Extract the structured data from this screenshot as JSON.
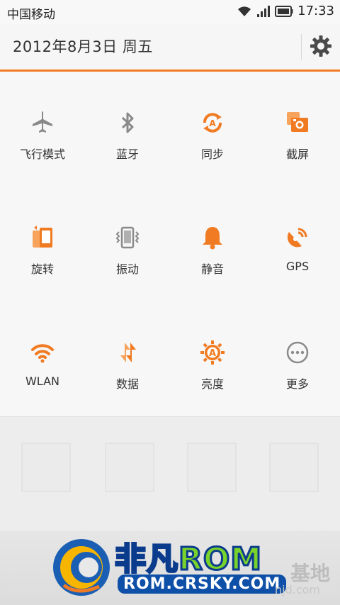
{
  "status_bar": {
    "carrier": "中国移动",
    "time": "17:33",
    "icons": [
      "wifi-icon",
      "signal-icon",
      "battery-icon"
    ]
  },
  "header": {
    "date": "2012年8月3日 周五",
    "settings_icon": "gear-icon"
  },
  "toggles": [
    {
      "label": "飞行模式",
      "icon": "airplane-icon",
      "active": false
    },
    {
      "label": "蓝牙",
      "icon": "bluetooth-icon",
      "active": false
    },
    {
      "label": "同步",
      "icon": "sync-icon",
      "active": true
    },
    {
      "label": "截屏",
      "icon": "screenshot-icon",
      "active": true
    },
    {
      "label": "旋转",
      "icon": "rotate-icon",
      "active": true
    },
    {
      "label": "振动",
      "icon": "vibrate-icon",
      "active": false
    },
    {
      "label": "静音",
      "icon": "bell-icon",
      "active": true
    },
    {
      "label": "GPS",
      "icon": "gps-icon",
      "active": true
    },
    {
      "label": "WLAN",
      "icon": "wifi-icon",
      "active": true
    },
    {
      "label": "数据",
      "icon": "data-icon",
      "active": true
    },
    {
      "label": "亮度",
      "icon": "brightness-icon",
      "active": true
    },
    {
      "label": "更多",
      "icon": "more-icon",
      "active": false
    }
  ],
  "colors": {
    "accent": "#f07b22",
    "inactive": "#8a8a8a",
    "text": "#333333"
  },
  "watermark": {
    "brand": "非凡ROM",
    "url": "ROM.CRSKY.COM",
    "suffix": "基地",
    "suffix_url": "njd.com"
  }
}
